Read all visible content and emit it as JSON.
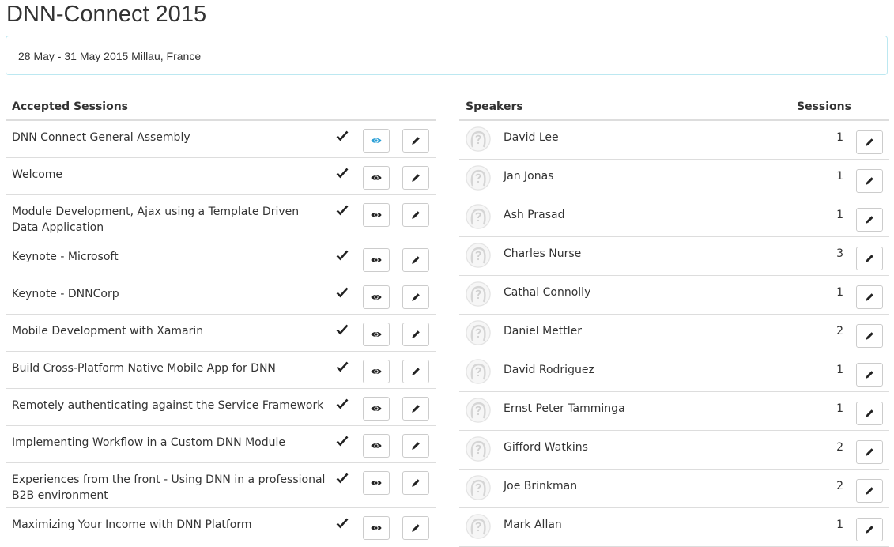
{
  "page": {
    "title": "DNN-Connect 2015",
    "info": "28 May - 31 May 2015 Millau, France"
  },
  "sessions": {
    "header": "Accepted Sessions",
    "items": [
      {
        "title": "DNN Connect General Assembly",
        "accepted": true
      },
      {
        "title": "Welcome",
        "accepted": true
      },
      {
        "title": "Module Development, Ajax using a Template Driven Data Application",
        "accepted": true
      },
      {
        "title": "Keynote - Microsoft",
        "accepted": true
      },
      {
        "title": "Keynote - DNNCorp",
        "accepted": true
      },
      {
        "title": "Mobile Development with Xamarin",
        "accepted": true
      },
      {
        "title": "Build Cross-Platform Native Mobile App for DNN",
        "accepted": true
      },
      {
        "title": "Remotely authenticating against the Service Framework",
        "accepted": true
      },
      {
        "title": "Implementing Workflow in a Custom DNN Module",
        "accepted": true
      },
      {
        "title": "Experiences from the front - Using DNN in a professional B2B environment",
        "accepted": true
      },
      {
        "title": "Maximizing Your Income with DNN Platform",
        "accepted": true
      }
    ]
  },
  "speakers": {
    "header": "Speakers",
    "sessions_header": "Sessions",
    "items": [
      {
        "name": "David Lee",
        "sessions": "1"
      },
      {
        "name": "Jan Jonas",
        "sessions": "1"
      },
      {
        "name": "Ash Prasad",
        "sessions": "1"
      },
      {
        "name": "Charles Nurse",
        "sessions": "3"
      },
      {
        "name": "Cathal Connolly",
        "sessions": "1"
      },
      {
        "name": "Daniel Mettler",
        "sessions": "2"
      },
      {
        "name": "David Rodriguez",
        "sessions": "1"
      },
      {
        "name": "Ernst Peter Tamminga",
        "sessions": "1"
      },
      {
        "name": "Gifford Watkins",
        "sessions": "2"
      },
      {
        "name": "Joe Brinkman",
        "sessions": "2"
      },
      {
        "name": "Mark Allan",
        "sessions": "1"
      }
    ]
  },
  "icons": {
    "check": "check-icon",
    "view": "eye-icon",
    "edit": "pencil-icon",
    "avatar": "default-avatar-icon"
  },
  "colors": {
    "border": "#dddddd",
    "info_border": "#bce8f1",
    "active_eye": "#2a9fd6"
  }
}
